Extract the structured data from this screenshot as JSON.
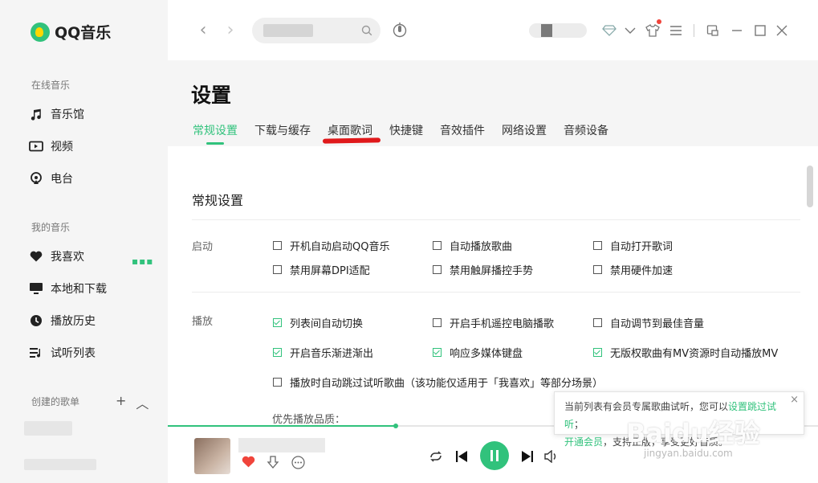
{
  "app": {
    "name": "QQ音乐"
  },
  "sidebar": {
    "online_section": "在线音乐",
    "online_items": [
      {
        "label": "音乐馆",
        "icon": "music-note-icon"
      },
      {
        "label": "视频",
        "icon": "video-icon"
      },
      {
        "label": "电台",
        "icon": "radio-icon"
      }
    ],
    "my_section": "我的音乐",
    "my_items": [
      {
        "label": "我喜欢",
        "icon": "heart-icon"
      },
      {
        "label": "本地和下载",
        "icon": "monitor-icon"
      },
      {
        "label": "播放历史",
        "icon": "clock-icon"
      },
      {
        "label": "试听列表",
        "icon": "playlist-icon"
      }
    ],
    "playlist_section": "创建的歌单",
    "add_symbol": "+",
    "collapse_symbol": "︿"
  },
  "topbar": {
    "search_placeholder": ""
  },
  "settings": {
    "title": "设置",
    "tabs": [
      {
        "label": "常规设置",
        "active": true
      },
      {
        "label": "下载与缓存",
        "active": false
      },
      {
        "label": "桌面歌词",
        "active": false
      },
      {
        "label": "快捷键",
        "active": false
      },
      {
        "label": "音效插件",
        "active": false
      },
      {
        "label": "网络设置",
        "active": false
      },
      {
        "label": "音频设备",
        "active": false
      }
    ],
    "section_title": "常规设置",
    "startup_label": "启动",
    "startup_options": [
      {
        "label": "开机自动启动QQ音乐",
        "checked": false
      },
      {
        "label": "自动播放歌曲",
        "checked": false
      },
      {
        "label": "自动打开歌词",
        "checked": false
      },
      {
        "label": "禁用屏幕DPI适配",
        "checked": false
      },
      {
        "label": "禁用触屏播控手势",
        "checked": false
      },
      {
        "label": "禁用硬件加速",
        "checked": false
      }
    ],
    "playback_label": "播放",
    "playback_options": [
      {
        "label": "列表间自动切换",
        "checked": true
      },
      {
        "label": "开启手机遥控电脑播歌",
        "checked": false
      },
      {
        "label": "自动调节到最佳音量",
        "checked": false
      },
      {
        "label": "开启音乐渐进渐出",
        "checked": true
      },
      {
        "label": "响应多媒体键盘",
        "checked": true
      },
      {
        "label": "无版权歌曲有MV资源时自动播放MV",
        "checked": true
      },
      {
        "label": "播放时自动跳过试听歌曲（该功能仅适用于「我喜欢」等部分场景）",
        "checked": false
      }
    ],
    "quality_label": "优先播放品质："
  },
  "toast": {
    "text_before": "当前列表有会员专属歌曲试听，您可以",
    "link1": "设置跳过试听",
    "text_mid": "；",
    "link2": "开通会员",
    "text_after": "，支持正版，享受更好音质。",
    "close": "×"
  },
  "player": {
    "progress": 0.35
  },
  "watermark": {
    "main": "Baidu经验",
    "sub": "jingyan.baidu.com"
  },
  "colors": {
    "accent": "#31c27c",
    "sidebar_bg": "#f5f5f5",
    "annotation_red": "#e0191b"
  }
}
